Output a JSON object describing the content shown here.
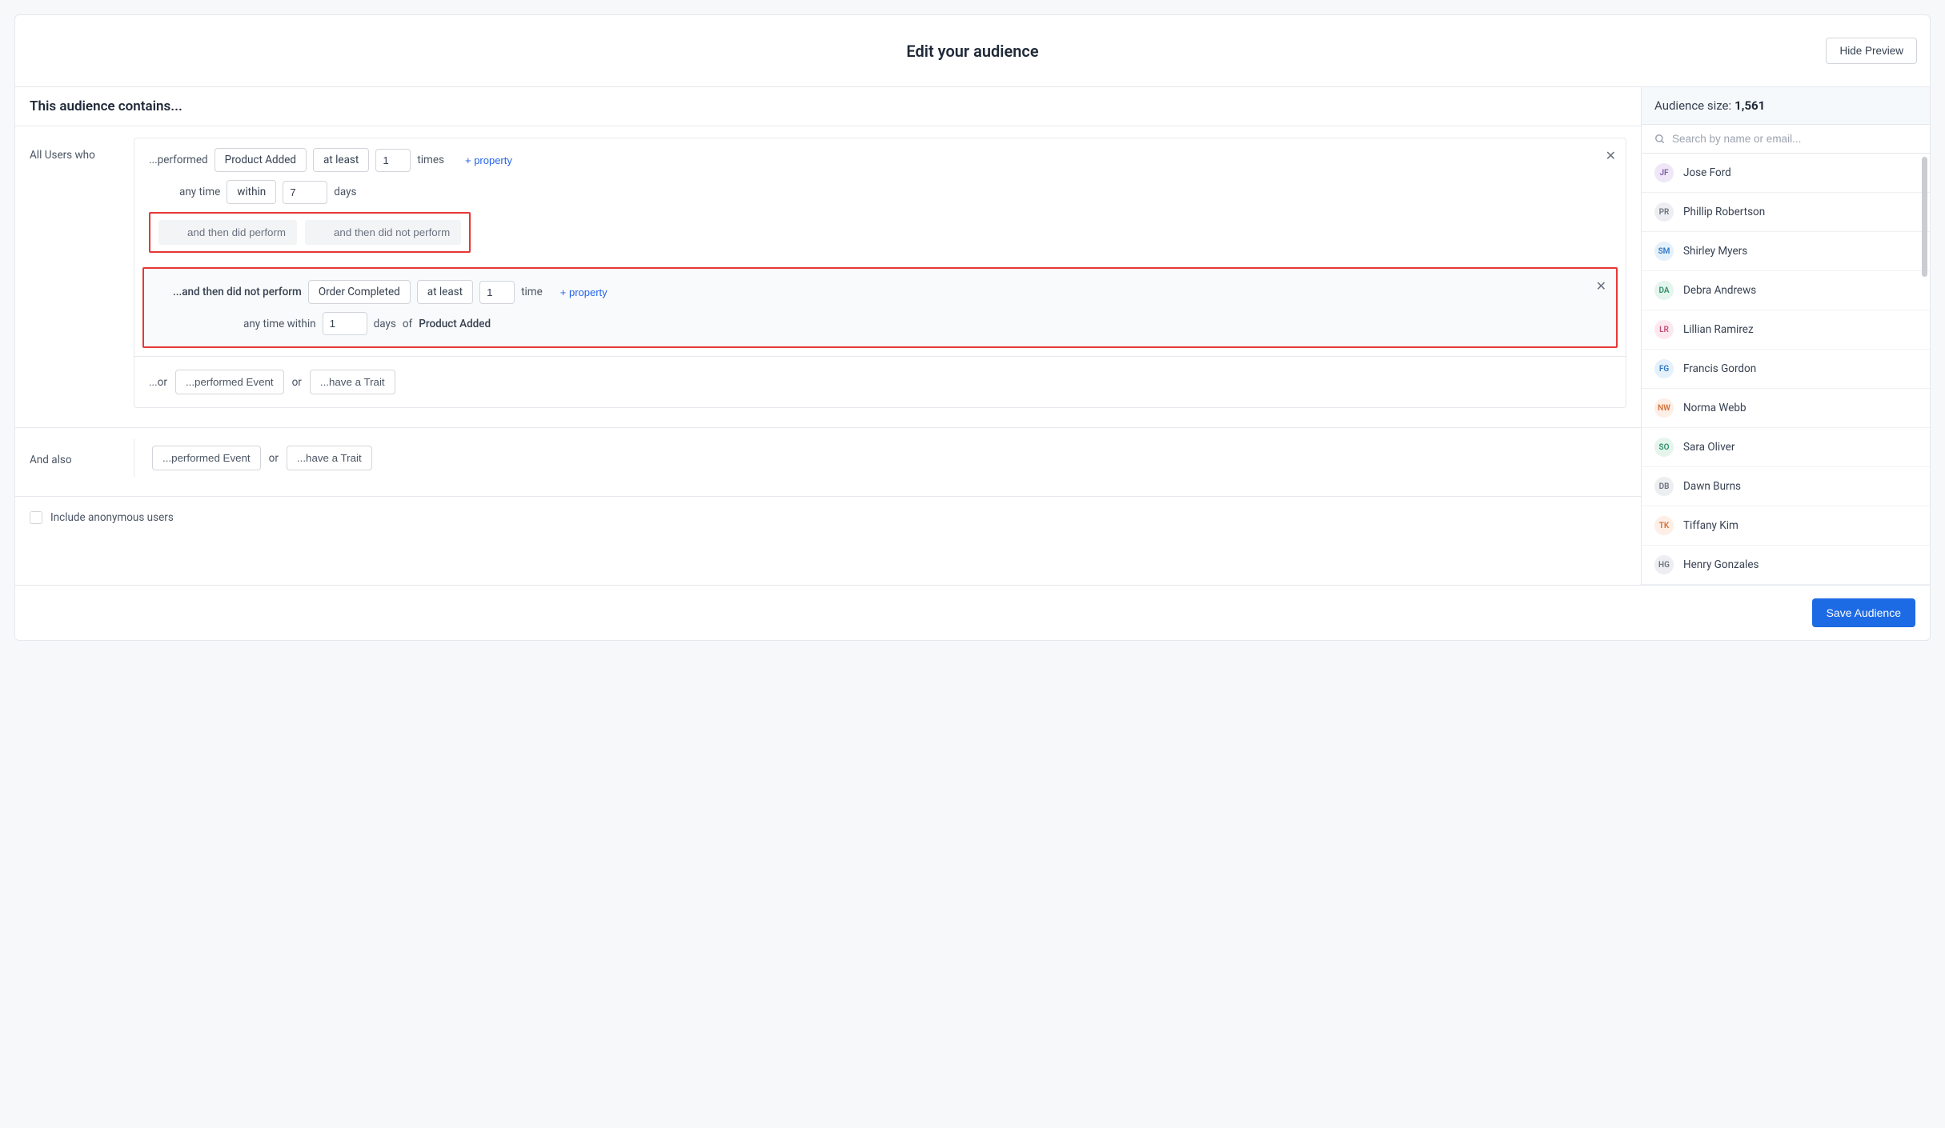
{
  "header": {
    "title": "Edit your audience",
    "hide_preview": "Hide Preview"
  },
  "contains_heading": "This audience contains...",
  "labels": {
    "all_users_who": "All Users who",
    "and_also": "And also"
  },
  "cond1": {
    "prefix": "...performed",
    "event": "Product Added",
    "op": "at least",
    "count": "1",
    "times": "times",
    "add_property": "+ property",
    "any_time": "any time",
    "within": "within",
    "within_value": "7",
    "within_unit": "days"
  },
  "then_buttons": {
    "did_perform": "and then did perform",
    "did_not_perform": "and then did not perform"
  },
  "cond2": {
    "prefix": "...and then did not perform",
    "event": "Order Completed",
    "op": "at least",
    "count": "1",
    "time_label": "time",
    "add_property": "+ property",
    "any_time_within": "any time within",
    "within_value": "1",
    "within_unit": "days",
    "of_label": "of",
    "ref_event": "Product Added"
  },
  "or_row": {
    "or_prefix": "...or",
    "performed_event": "...performed Event",
    "or_sep": "or",
    "have_trait": "...have a Trait"
  },
  "anon": {
    "label": "Include anonymous users",
    "checked": false
  },
  "size_bar": {
    "label": "Audience size:",
    "value": "1,561"
  },
  "search": {
    "placeholder": "Search by name or email..."
  },
  "people": [
    {
      "initials": "JF",
      "name": "Jose Ford",
      "bg": "#efe7f7",
      "fg": "#7c5aa6"
    },
    {
      "initials": "PR",
      "name": "Phillip Robertson",
      "bg": "#eceef1",
      "fg": "#6b7280"
    },
    {
      "initials": "SM",
      "name": "Shirley Myers",
      "bg": "#e4f1fb",
      "fg": "#2f78c4"
    },
    {
      "initials": "DA",
      "name": "Debra Andrews",
      "bg": "#e5f5ee",
      "fg": "#2e8f6b"
    },
    {
      "initials": "LR",
      "name": "Lillian Ramirez",
      "bg": "#fbe9ef",
      "fg": "#c44d7a"
    },
    {
      "initials": "FG",
      "name": "Francis Gordon",
      "bg": "#e4f1fb",
      "fg": "#2f78c4"
    },
    {
      "initials": "NW",
      "name": "Norma Webb",
      "bg": "#fdeee6",
      "fg": "#d1713a"
    },
    {
      "initials": "SO",
      "name": "Sara Oliver",
      "bg": "#e5f5ee",
      "fg": "#2e8f6b"
    },
    {
      "initials": "DB",
      "name": "Dawn Burns",
      "bg": "#eceef1",
      "fg": "#6b7280"
    },
    {
      "initials": "TK",
      "name": "Tiffany Kim",
      "bg": "#fdeee6",
      "fg": "#d1713a"
    },
    {
      "initials": "HG",
      "name": "Henry Gonzales",
      "bg": "#eceef1",
      "fg": "#6b7280"
    }
  ],
  "footer": {
    "save": "Save Audience"
  }
}
